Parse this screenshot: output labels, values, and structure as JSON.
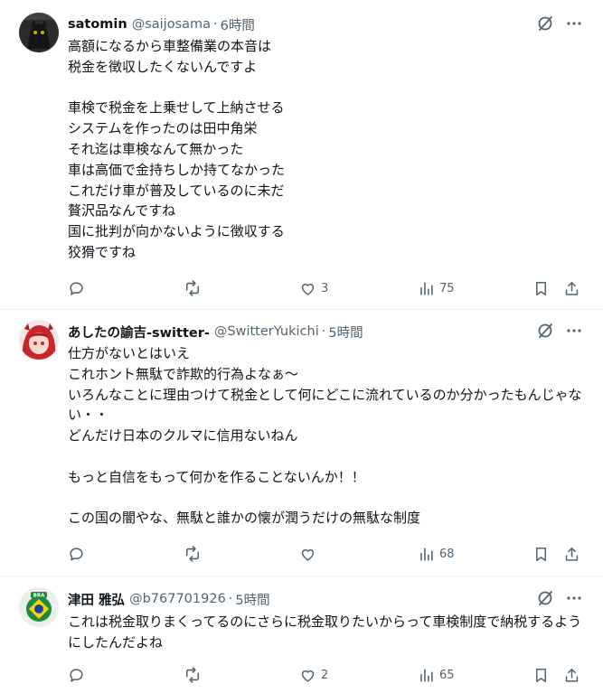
{
  "posts": [
    {
      "name": "satomin",
      "handle": "@saijosama",
      "separator": "·",
      "time": "6時間",
      "text": "高額になるから車整備業の本音は\n税金を徴収したくないんですよ\n\n車検で税金を上乗せして上納させる\nシステムを作ったのは田中角栄\nそれ迄は車検なんて無かった\n車は高価で金持ちしか持てなかった\nこれだけ車が普及しているのに未だ\n贅沢品なんですね\n国に批判が向かないように徴収する\n狡猾ですね",
      "likes": "3",
      "views": "75"
    },
    {
      "name": "あしたの諭吉-switter-",
      "handle": "@SwitterYukichi",
      "separator": "·",
      "time": "5時間",
      "text": "仕方がないとはいえ\nこれホント無駄で詐欺的行為よなぁ～\nいろんなことに理由つけて税金として何にどこに流れているのか分かったもんじゃない・・\nどんだけ日本のクルマに信用ないねん\n\nもっと自信をもって何かを作ることないんか！！\n\nこの国の闇やな、無駄と誰かの懐が潤うだけの無駄な制度",
      "likes": "",
      "views": "68"
    },
    {
      "name": "津田 雅弘",
      "handle": "@b767701926",
      "separator": "·",
      "time": "5時間",
      "text": "これは税金取りまくってるのにさらに税金取りたいからって車検制度で納税するようにしたんだよね",
      "likes": "2",
      "views": "65"
    }
  ],
  "avatar_badge": "BRA",
  "icons": {
    "grok": "grok-icon",
    "more": "more-icon",
    "reply": "reply-icon",
    "repost": "repost-icon",
    "like": "like-icon",
    "views": "views-icon",
    "bookmark": "bookmark-icon",
    "share": "share-icon"
  },
  "colors": {
    "text": "#0f1419",
    "secondary": "#536471",
    "divider": "#eff3f4"
  }
}
